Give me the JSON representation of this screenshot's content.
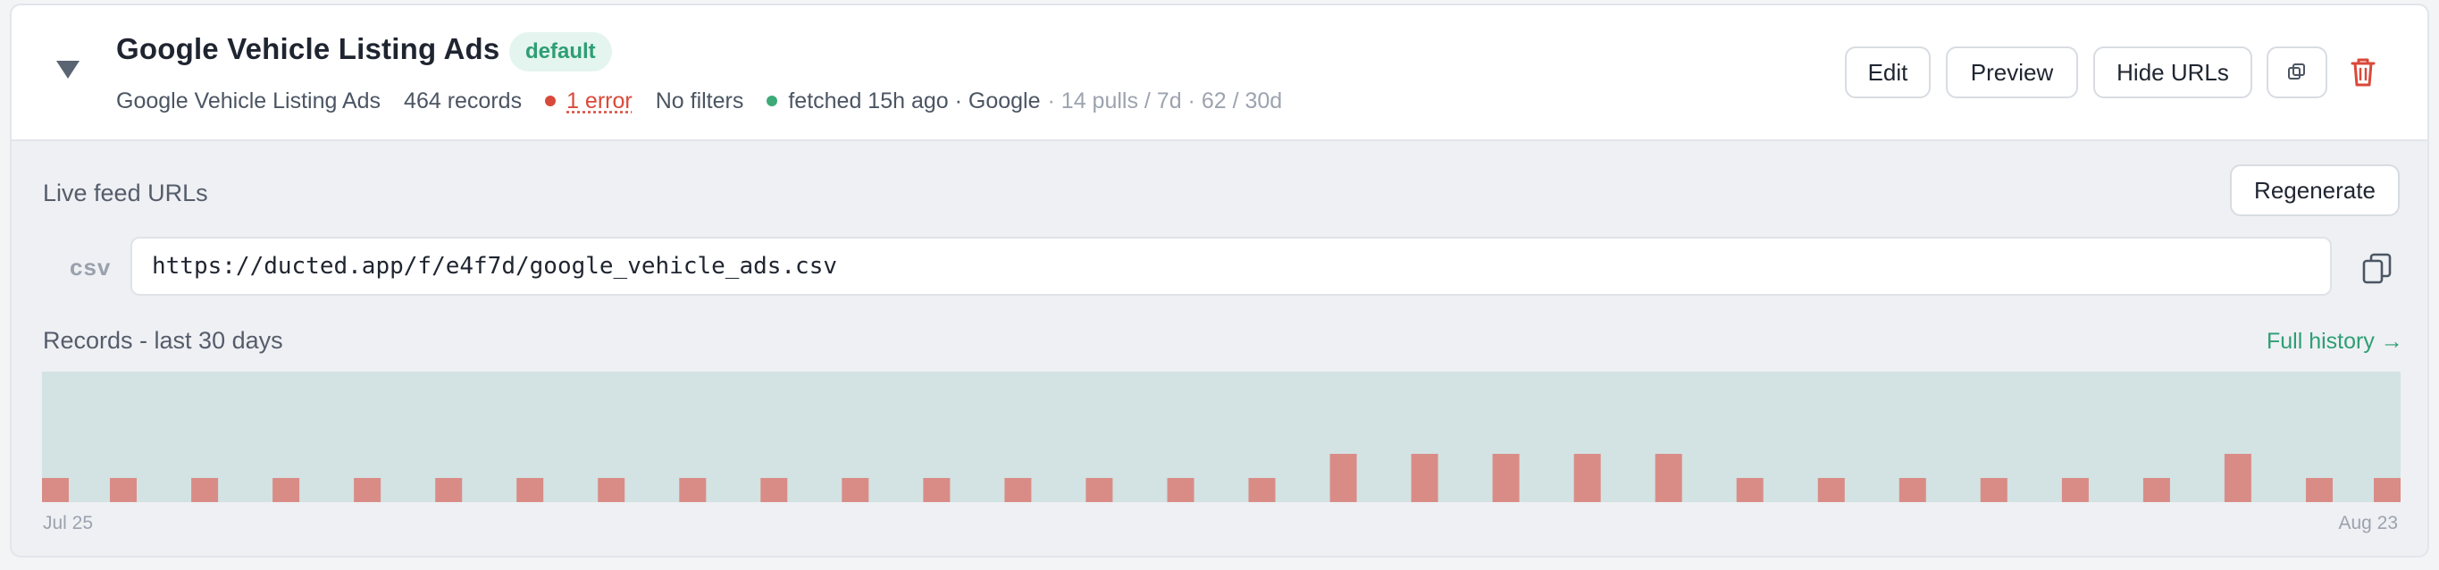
{
  "feed": {
    "title": "Google Vehicle Listing Ads",
    "badge": "default",
    "source": "Google Vehicle Listing Ads",
    "records": "464 records",
    "errors": "1 error",
    "filters": "No filters",
    "fetched": "fetched 15h ago · Google",
    "pulls": "· 14 pulls / 7d · 62 / 30d"
  },
  "toolbar": {
    "edit_label": "Edit",
    "preview_label": "Preview",
    "hide_urls_label": "Hide URLs"
  },
  "urls": {
    "section_label": "Live feed URLs",
    "regenerate_label": "Regenerate",
    "format": "csv",
    "url": "https://ducted.app/f/e4f7d/google_vehicle_ads.csv"
  },
  "records_chart": {
    "label": "Records - last 30 days",
    "history_link": "Full history →",
    "start_date": "Jul 25",
    "end_date": "Aug 23"
  },
  "colors": {
    "accent": "#2e9e74",
    "error": "#d9493a",
    "line": "#2e8a72",
    "area": "#d3e2e3",
    "bar": "#d98c86"
  },
  "icons": {
    "toggle": "triangle-down-icon",
    "duplicate": "duplicate-icon",
    "delete": "trash-icon",
    "copy": "copy-icon"
  },
  "chart_data": {
    "type": "area",
    "series": [
      {
        "values": [
          459,
          460,
          461,
          462,
          461,
          464,
          460,
          462,
          460,
          461,
          461,
          461,
          460,
          462,
          462,
          461,
          460,
          460,
          461,
          460,
          461,
          463,
          462,
          462,
          462,
          460,
          461,
          462,
          462,
          462
        ]
      },
      {
        "values": [
          1,
          1,
          1,
          1,
          1,
          1,
          1,
          1,
          1,
          1,
          1,
          1,
          1,
          1,
          1,
          1,
          2,
          2,
          2,
          2,
          2,
          1,
          1,
          1,
          1,
          1,
          1,
          2,
          1,
          1
        ]
      }
    ],
    "x_range": [
      "Jul 25",
      "Aug 23"
    ],
    "grid": false
  }
}
